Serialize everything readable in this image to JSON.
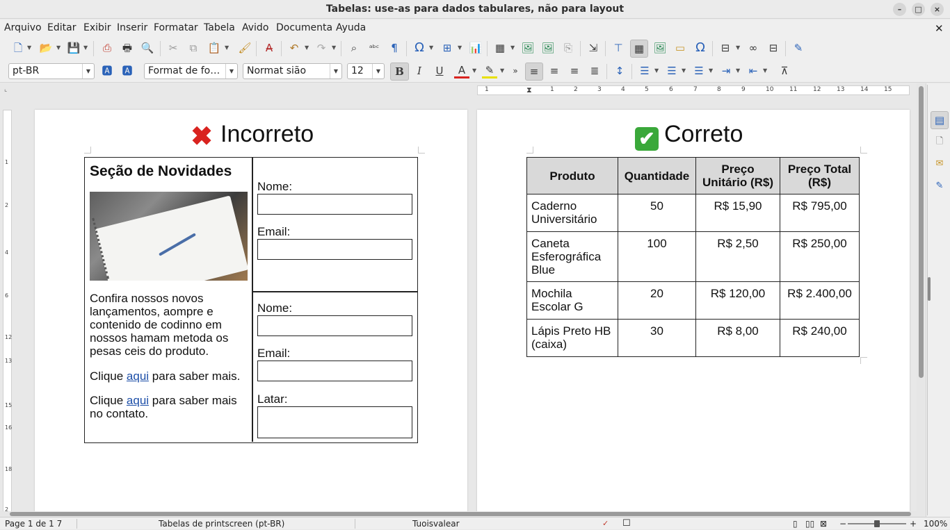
{
  "window": {
    "title": "Tabelas: use-as para dados tabulares, não para layout"
  },
  "menu": [
    "Arquivo",
    "Editar",
    "Exibir",
    "Inserir",
    "Formatar",
    "Tabela",
    "Avido",
    "Documenta",
    "Ayuda"
  ],
  "format_bar": {
    "language": "pt-BR",
    "paragraph_style": "Format de fo…",
    "font_name": "Normat sião",
    "font_size": "12"
  },
  "ruler": {
    "h_ticks": [
      "1",
      "1",
      "2",
      "3",
      "4",
      "5",
      "6",
      "7",
      "8",
      "9",
      "10",
      "11",
      "12",
      "13",
      "14",
      "15"
    ],
    "v_ticks": [
      "1",
      "2",
      "4",
      "6",
      "12",
      "13",
      "15",
      "16",
      "18",
      "2"
    ]
  },
  "left_page": {
    "heading": "Incorreto",
    "section_title": "Seção de Novidades",
    "body_text": "Confira nossos novos lançamentos, aompre e contenido de codinno em nossos hamam metoda os pesas ceis do produto.",
    "link1_pre": "Clique ",
    "link1_text": "aqui",
    "link1_post": " para saber mais.",
    "link2_pre": "Clique ",
    "link2_text": "aqui",
    "link2_post": " para saber mais no contato.",
    "form1": {
      "name_label": "Nome:",
      "email_label": "Email:"
    },
    "form2": {
      "name_label": "Nome:",
      "email_label": "Email:",
      "extra_label": "Latar:"
    }
  },
  "right_page": {
    "heading": "Correto",
    "table": {
      "headers": [
        "Produto",
        "Quantidade",
        "Preço Unitário (R$)",
        "Preço Total (R$)"
      ],
      "rows": [
        [
          "Caderno Universitário",
          "50",
          "R$ 15,90",
          "R$ 795,00"
        ],
        [
          "Caneta Esferográfica Blue",
          "100",
          "R$ 2,50",
          "R$ 250,00"
        ],
        [
          "Mochila Escolar G",
          "20",
          "R$ 120,00",
          "R$ 2.400,00"
        ],
        [
          "Lápis Preto HB (caixa)",
          "30",
          "R$ 8,00",
          "R$ 240,00"
        ]
      ]
    }
  },
  "status": {
    "page": "Page 1 de 1 7",
    "doc": "Tabelas de printscreen (pt-BR)",
    "mode": "Tuoisvalear",
    "zoom": "100%"
  },
  "colors": {
    "incorrect_mark": "#d9231f",
    "correct_mark": "#3aa83a",
    "link": "#1d4fa8"
  }
}
